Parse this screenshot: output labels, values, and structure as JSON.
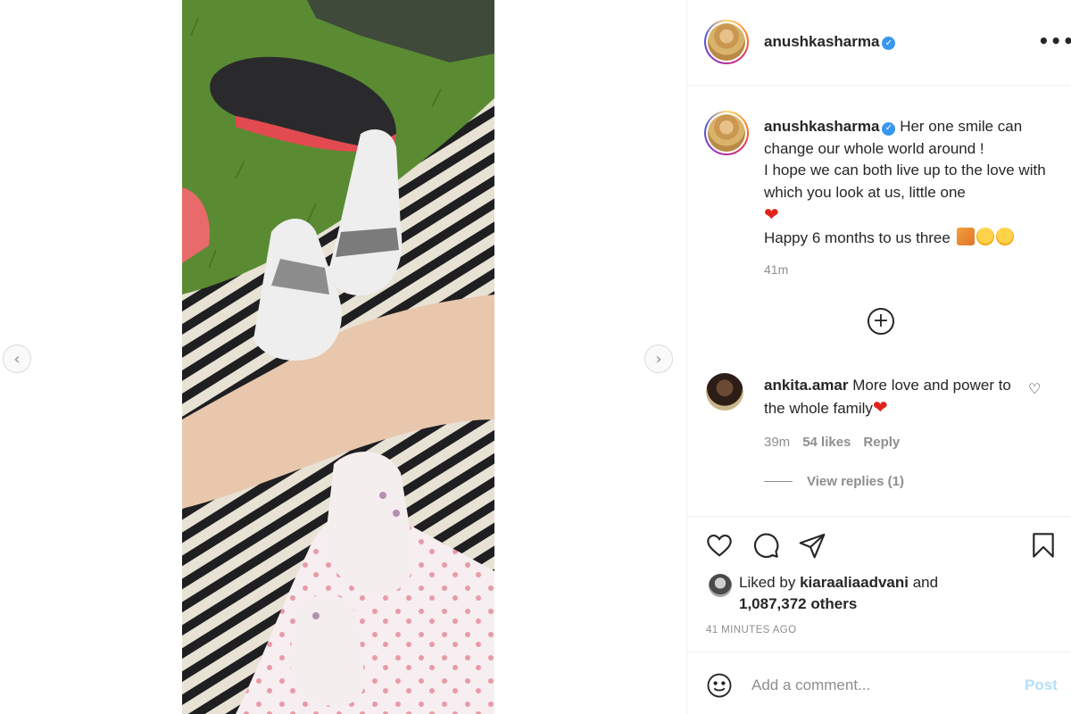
{
  "post": {
    "username": "anushkasharma",
    "verified": true,
    "more_icon": "more-options-icon",
    "caption": {
      "text_line1": "Her one smile can change our whole world around !",
      "text_line2": "I hope we can both live up to the love with which you look at us, little one",
      "heart": "❤",
      "text_line3": "Happy 6 months to us three",
      "time": "41m"
    },
    "carousel": {
      "prev_label": "‹",
      "next_label": "›",
      "slide_count": 3,
      "active_slide": 1
    },
    "load_more_label": "+",
    "comments": [
      {
        "username": "ankita.amar",
        "text": "More love and power to the whole family",
        "heart": "❤",
        "time": "39m",
        "likes": "54 likes",
        "reply_label": "Reply",
        "view_replies": "View replies (1)"
      }
    ],
    "actions": {
      "like_icon": "heart-icon",
      "comment_icon": "comment-icon",
      "share_icon": "share-icon",
      "save_icon": "bookmark-icon"
    },
    "likes": {
      "prefix": "Liked by",
      "liker": "kiaraaliaadvani",
      "joiner": "and",
      "others": "1,087,372 others"
    },
    "timestamp": "41 MINUTES AGO",
    "comment_box": {
      "placeholder": "Add a comment...",
      "post_label": "Post",
      "emoji_icon": "smiley-icon"
    }
  },
  "colors": {
    "verified_blue": "#3897f0",
    "muted_text": "#8e8e8e",
    "post_button_disabled": "#b2dffc",
    "heart_red": "#e0241c"
  }
}
